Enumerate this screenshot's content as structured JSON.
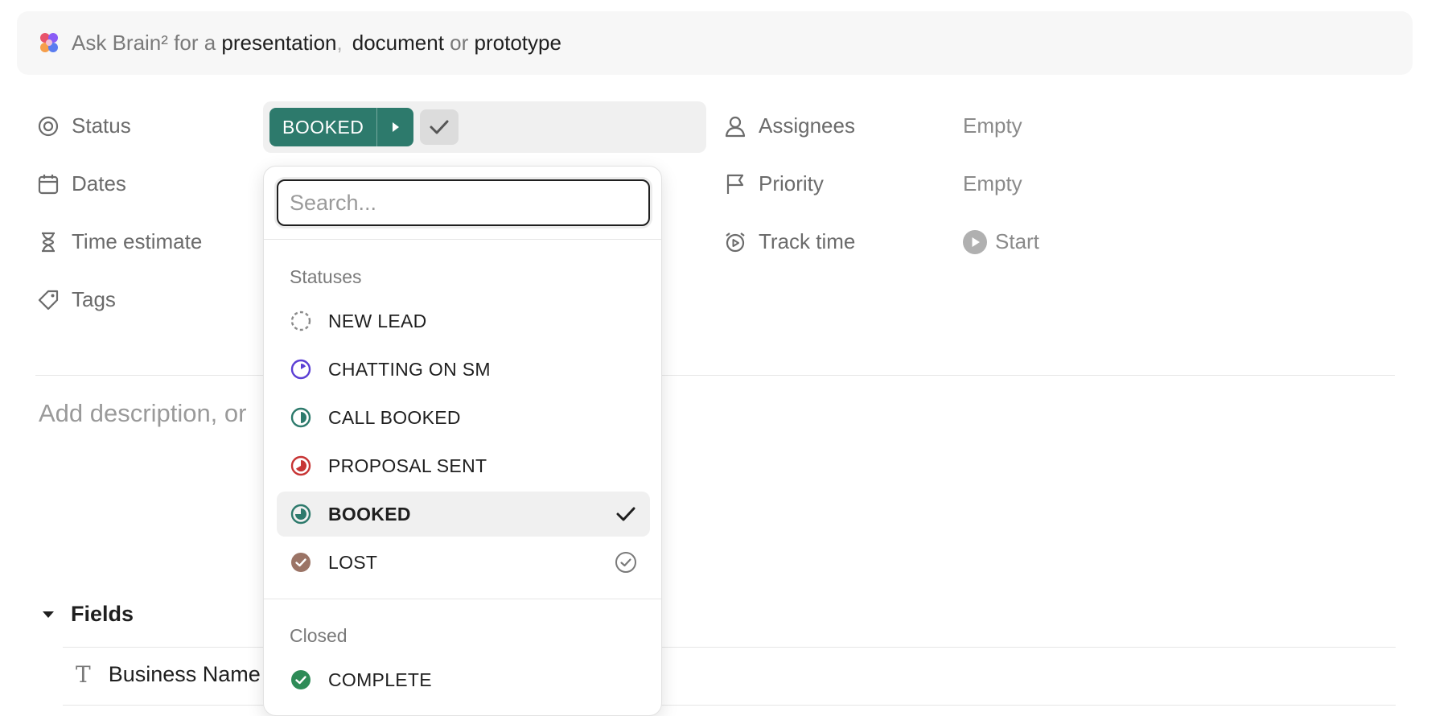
{
  "brain_bar": {
    "prefix": "Ask Brain² for a ",
    "kw1": "presentation",
    "sep1": ",",
    "kw2": "document",
    "sep2": " or ",
    "kw3": "prototype"
  },
  "properties": {
    "status_label": "Status",
    "dates_label": "Dates",
    "time_estimate_label": "Time estimate",
    "tags_label": "Tags",
    "assignees_label": "Assignees",
    "assignees_value": "Empty",
    "priority_label": "Priority",
    "priority_value": "Empty",
    "track_time_label": "Track time",
    "track_time_value": "Start"
  },
  "status": {
    "current": "BOOKED",
    "color": "#2d7a6c"
  },
  "description_placeholder": "Add description, or",
  "fields": {
    "heading": "Fields",
    "rows": [
      {
        "label": "Business Name"
      }
    ]
  },
  "dropdown": {
    "search_placeholder": "Search...",
    "sections": [
      {
        "title": "Statuses",
        "items": [
          {
            "label": "NEW LEAD",
            "icon": "dashed-circle-icon",
            "color": "#8a8a8a"
          },
          {
            "label": "CHATTING ON SM",
            "icon": "progress-circle-icon",
            "color": "#5b3fd4"
          },
          {
            "label": "CALL BOOKED",
            "icon": "progress-circle-icon",
            "color": "#2d7a6c"
          },
          {
            "label": "PROPOSAL SENT",
            "icon": "progress-circle-icon",
            "color": "#c73434"
          },
          {
            "label": "BOOKED",
            "icon": "progress-circle-icon",
            "color": "#2d7a6c",
            "selected": true
          },
          {
            "label": "LOST",
            "icon": "check-circle-filled-icon",
            "color": "#9b7466"
          }
        ]
      },
      {
        "title": "Closed",
        "items": [
          {
            "label": "COMPLETE",
            "icon": "check-circle-filled-icon",
            "color": "#2e8b57"
          }
        ]
      }
    ]
  }
}
